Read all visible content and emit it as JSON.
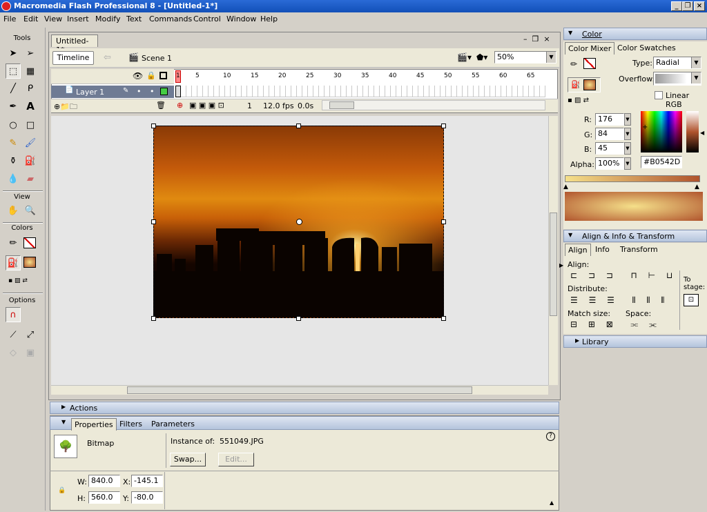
{
  "window": {
    "title": "Macromedia Flash Professional 8 - [Untitled-1*]"
  },
  "menu": [
    "File",
    "Edit",
    "View",
    "Insert",
    "Modify",
    "Text",
    "Commands",
    "Control",
    "Window",
    "Help"
  ],
  "tools": {
    "tools_label": "Tools",
    "view_label": "View",
    "colors_label": "Colors",
    "options_label": "Options"
  },
  "document": {
    "tab": "Untitled-1*",
    "timeline_btn": "Timeline",
    "scene": "Scene 1",
    "zoom": "50%",
    "layer": "Layer 1",
    "frame_ticks": [
      "1",
      "5",
      "10",
      "15",
      "20",
      "25",
      "30",
      "35",
      "40",
      "45",
      "50",
      "55",
      "60",
      "65"
    ],
    "current_frame": "1",
    "fps": "12.0 fps",
    "time": "0.0s"
  },
  "actions": {
    "label": "Actions"
  },
  "properties": {
    "tabs": [
      "Properties",
      "Filters",
      "Parameters"
    ],
    "type": "Bitmap",
    "instance_label": "Instance of:",
    "instance_value": "551049.JPG",
    "swap": "Swap...",
    "edit": "Edit...",
    "w_label": "W:",
    "w": "840.0",
    "h_label": "H:",
    "h": "560.0",
    "x_label": "X:",
    "x": "-145.1",
    "y_label": "Y:",
    "y": "-80.0"
  },
  "color": {
    "title": "Color",
    "tabs": [
      "Color Mixer",
      "Color Swatches"
    ],
    "type_label": "Type:",
    "type": "Radial",
    "overflow_label": "Overflow:",
    "linear_rgb": "Linear RGB",
    "r_label": "R:",
    "r": "176",
    "g_label": "G:",
    "g": "84",
    "b_label": "B:",
    "b": "45",
    "alpha_label": "Alpha:",
    "alpha": "100%",
    "hex": "#B0542D",
    "accent": "#B0542D"
  },
  "align": {
    "title": "Align & Info & Transform",
    "tabs": [
      "Align",
      "Info",
      "Transform"
    ],
    "align_label": "Align:",
    "distribute_label": "Distribute:",
    "match_label": "Match size:",
    "space_label": "Space:",
    "to_stage_label": "To stage:"
  },
  "library": {
    "title": "Library"
  }
}
